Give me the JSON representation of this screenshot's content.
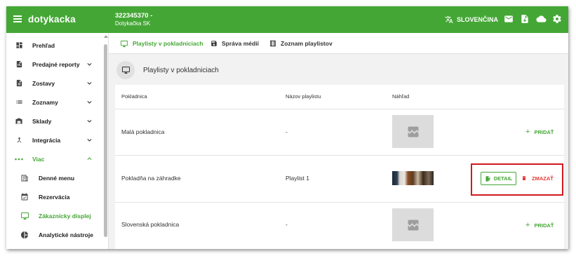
{
  "header": {
    "brand": "dotykacka",
    "account_id": "322345370  -",
    "account_name": "Dotykačka SK",
    "language": "SLOVENČINA",
    "icons": [
      "menu-icon",
      "translate-icon",
      "mail-icon",
      "file-download-icon",
      "cloud-icon",
      "gear-icon"
    ]
  },
  "sidebar": {
    "items": [
      {
        "label": "Prehľad",
        "icon": "dashboard-icon"
      },
      {
        "label": "Predajné reporty",
        "icon": "report-icon"
      },
      {
        "label": "Zostavy",
        "icon": "document-icon"
      },
      {
        "label": "Zoznamy",
        "icon": "list-icon"
      },
      {
        "label": "Sklady",
        "icon": "warehouse-icon"
      },
      {
        "label": "Integrácia",
        "icon": "merge-icon"
      },
      {
        "label": "Viac",
        "icon": "more-icon"
      },
      {
        "label": "Denné menu",
        "icon": "menu-book-icon"
      },
      {
        "label": "Rezervácia",
        "icon": "calendar-check-icon"
      },
      {
        "label": "Zákaznícky displej",
        "icon": "monitor-icon"
      },
      {
        "label": "Analytické nástroje",
        "icon": "pie-chart-icon"
      }
    ]
  },
  "tabs": [
    {
      "label": "Playlisty v pokladniciach",
      "icon": "monitor-icon"
    },
    {
      "label": "Správa médií",
      "icon": "save-icon"
    },
    {
      "label": "Zoznam playlistov",
      "icon": "book-icon"
    }
  ],
  "section": {
    "title": "Playlisty v pokladniciach"
  },
  "table": {
    "columns": [
      "Pokladnica",
      "Názov playlistu",
      "Náhľad"
    ],
    "rows": [
      {
        "register": "Malá pokladnica",
        "playlist": "-",
        "action": "PRIDAŤ"
      },
      {
        "register": "Pokladňa na záhradke",
        "playlist": "Playlist 1",
        "detail": "DETAIL",
        "delete": "ZMAZAŤ"
      },
      {
        "register": "Slovenská pokladnica",
        "playlist": "-",
        "action": "PRIDAŤ"
      }
    ]
  },
  "colors": {
    "accent": "#44a735",
    "danger": "#e53935",
    "highlight": "#d0191e"
  }
}
